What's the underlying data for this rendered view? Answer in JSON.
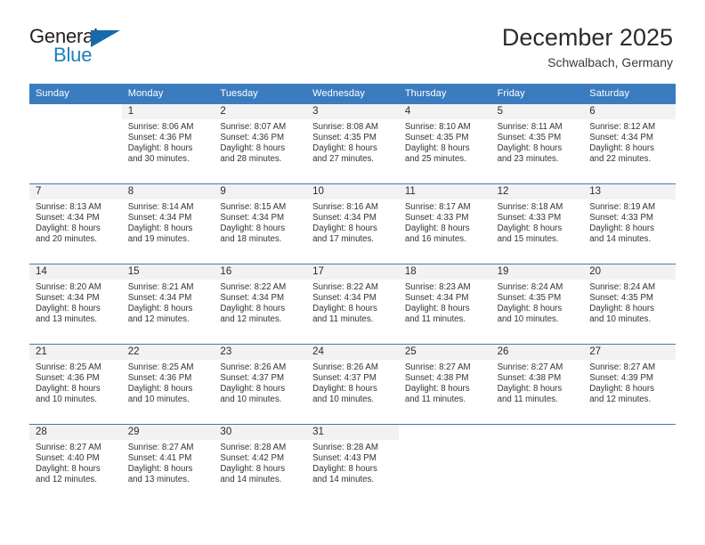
{
  "brand": {
    "word_general": "General",
    "word_blue": "Blue",
    "triangle_color": "#1769aa",
    "blue_color": "#1a7fc1"
  },
  "header": {
    "title": "December 2025",
    "subtitle": "Schwalbach, Germany"
  },
  "colors": {
    "header_blue": "#3b7cbf",
    "day_band_gray": "#f2f2f2",
    "text": "#333333"
  },
  "weekdays": [
    "Sunday",
    "Monday",
    "Tuesday",
    "Wednesday",
    "Thursday",
    "Friday",
    "Saturday"
  ],
  "weeks": [
    [
      {
        "day": "",
        "sunrise": "",
        "sunset": "",
        "daylight1": "",
        "daylight2": ""
      },
      {
        "day": "1",
        "sunrise": "Sunrise: 8:06 AM",
        "sunset": "Sunset: 4:36 PM",
        "daylight1": "Daylight: 8 hours",
        "daylight2": "and 30 minutes."
      },
      {
        "day": "2",
        "sunrise": "Sunrise: 8:07 AM",
        "sunset": "Sunset: 4:36 PM",
        "daylight1": "Daylight: 8 hours",
        "daylight2": "and 28 minutes."
      },
      {
        "day": "3",
        "sunrise": "Sunrise: 8:08 AM",
        "sunset": "Sunset: 4:35 PM",
        "daylight1": "Daylight: 8 hours",
        "daylight2": "and 27 minutes."
      },
      {
        "day": "4",
        "sunrise": "Sunrise: 8:10 AM",
        "sunset": "Sunset: 4:35 PM",
        "daylight1": "Daylight: 8 hours",
        "daylight2": "and 25 minutes."
      },
      {
        "day": "5",
        "sunrise": "Sunrise: 8:11 AM",
        "sunset": "Sunset: 4:35 PM",
        "daylight1": "Daylight: 8 hours",
        "daylight2": "and 23 minutes."
      },
      {
        "day": "6",
        "sunrise": "Sunrise: 8:12 AM",
        "sunset": "Sunset: 4:34 PM",
        "daylight1": "Daylight: 8 hours",
        "daylight2": "and 22 minutes."
      }
    ],
    [
      {
        "day": "7",
        "sunrise": "Sunrise: 8:13 AM",
        "sunset": "Sunset: 4:34 PM",
        "daylight1": "Daylight: 8 hours",
        "daylight2": "and 20 minutes."
      },
      {
        "day": "8",
        "sunrise": "Sunrise: 8:14 AM",
        "sunset": "Sunset: 4:34 PM",
        "daylight1": "Daylight: 8 hours",
        "daylight2": "and 19 minutes."
      },
      {
        "day": "9",
        "sunrise": "Sunrise: 8:15 AM",
        "sunset": "Sunset: 4:34 PM",
        "daylight1": "Daylight: 8 hours",
        "daylight2": "and 18 minutes."
      },
      {
        "day": "10",
        "sunrise": "Sunrise: 8:16 AM",
        "sunset": "Sunset: 4:34 PM",
        "daylight1": "Daylight: 8 hours",
        "daylight2": "and 17 minutes."
      },
      {
        "day": "11",
        "sunrise": "Sunrise: 8:17 AM",
        "sunset": "Sunset: 4:33 PM",
        "daylight1": "Daylight: 8 hours",
        "daylight2": "and 16 minutes."
      },
      {
        "day": "12",
        "sunrise": "Sunrise: 8:18 AM",
        "sunset": "Sunset: 4:33 PM",
        "daylight1": "Daylight: 8 hours",
        "daylight2": "and 15 minutes."
      },
      {
        "day": "13",
        "sunrise": "Sunrise: 8:19 AM",
        "sunset": "Sunset: 4:33 PM",
        "daylight1": "Daylight: 8 hours",
        "daylight2": "and 14 minutes."
      }
    ],
    [
      {
        "day": "14",
        "sunrise": "Sunrise: 8:20 AM",
        "sunset": "Sunset: 4:34 PM",
        "daylight1": "Daylight: 8 hours",
        "daylight2": "and 13 minutes."
      },
      {
        "day": "15",
        "sunrise": "Sunrise: 8:21 AM",
        "sunset": "Sunset: 4:34 PM",
        "daylight1": "Daylight: 8 hours",
        "daylight2": "and 12 minutes."
      },
      {
        "day": "16",
        "sunrise": "Sunrise: 8:22 AM",
        "sunset": "Sunset: 4:34 PM",
        "daylight1": "Daylight: 8 hours",
        "daylight2": "and 12 minutes."
      },
      {
        "day": "17",
        "sunrise": "Sunrise: 8:22 AM",
        "sunset": "Sunset: 4:34 PM",
        "daylight1": "Daylight: 8 hours",
        "daylight2": "and 11 minutes."
      },
      {
        "day": "18",
        "sunrise": "Sunrise: 8:23 AM",
        "sunset": "Sunset: 4:34 PM",
        "daylight1": "Daylight: 8 hours",
        "daylight2": "and 11 minutes."
      },
      {
        "day": "19",
        "sunrise": "Sunrise: 8:24 AM",
        "sunset": "Sunset: 4:35 PM",
        "daylight1": "Daylight: 8 hours",
        "daylight2": "and 10 minutes."
      },
      {
        "day": "20",
        "sunrise": "Sunrise: 8:24 AM",
        "sunset": "Sunset: 4:35 PM",
        "daylight1": "Daylight: 8 hours",
        "daylight2": "and 10 minutes."
      }
    ],
    [
      {
        "day": "21",
        "sunrise": "Sunrise: 8:25 AM",
        "sunset": "Sunset: 4:36 PM",
        "daylight1": "Daylight: 8 hours",
        "daylight2": "and 10 minutes."
      },
      {
        "day": "22",
        "sunrise": "Sunrise: 8:25 AM",
        "sunset": "Sunset: 4:36 PM",
        "daylight1": "Daylight: 8 hours",
        "daylight2": "and 10 minutes."
      },
      {
        "day": "23",
        "sunrise": "Sunrise: 8:26 AM",
        "sunset": "Sunset: 4:37 PM",
        "daylight1": "Daylight: 8 hours",
        "daylight2": "and 10 minutes."
      },
      {
        "day": "24",
        "sunrise": "Sunrise: 8:26 AM",
        "sunset": "Sunset: 4:37 PM",
        "daylight1": "Daylight: 8 hours",
        "daylight2": "and 10 minutes."
      },
      {
        "day": "25",
        "sunrise": "Sunrise: 8:27 AM",
        "sunset": "Sunset: 4:38 PM",
        "daylight1": "Daylight: 8 hours",
        "daylight2": "and 11 minutes."
      },
      {
        "day": "26",
        "sunrise": "Sunrise: 8:27 AM",
        "sunset": "Sunset: 4:38 PM",
        "daylight1": "Daylight: 8 hours",
        "daylight2": "and 11 minutes."
      },
      {
        "day": "27",
        "sunrise": "Sunrise: 8:27 AM",
        "sunset": "Sunset: 4:39 PM",
        "daylight1": "Daylight: 8 hours",
        "daylight2": "and 12 minutes."
      }
    ],
    [
      {
        "day": "28",
        "sunrise": "Sunrise: 8:27 AM",
        "sunset": "Sunset: 4:40 PM",
        "daylight1": "Daylight: 8 hours",
        "daylight2": "and 12 minutes."
      },
      {
        "day": "29",
        "sunrise": "Sunrise: 8:27 AM",
        "sunset": "Sunset: 4:41 PM",
        "daylight1": "Daylight: 8 hours",
        "daylight2": "and 13 minutes."
      },
      {
        "day": "30",
        "sunrise": "Sunrise: 8:28 AM",
        "sunset": "Sunset: 4:42 PM",
        "daylight1": "Daylight: 8 hours",
        "daylight2": "and 14 minutes."
      },
      {
        "day": "31",
        "sunrise": "Sunrise: 8:28 AM",
        "sunset": "Sunset: 4:43 PM",
        "daylight1": "Daylight: 8 hours",
        "daylight2": "and 14 minutes."
      },
      {
        "day": "",
        "sunrise": "",
        "sunset": "",
        "daylight1": "",
        "daylight2": ""
      },
      {
        "day": "",
        "sunrise": "",
        "sunset": "",
        "daylight1": "",
        "daylight2": ""
      },
      {
        "day": "",
        "sunrise": "",
        "sunset": "",
        "daylight1": "",
        "daylight2": ""
      }
    ]
  ]
}
